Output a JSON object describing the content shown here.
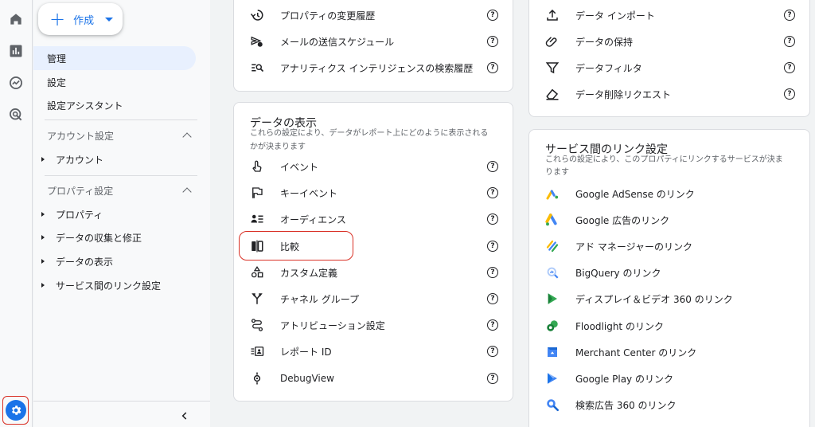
{
  "rail": {
    "icons": [
      "home-icon",
      "reports-icon",
      "explore-icon",
      "advertising-icon",
      "gear-icon"
    ]
  },
  "sidebar": {
    "create_label": "作成",
    "top_items": [
      "管理",
      "設定",
      "設定アシスタント"
    ],
    "account_section": {
      "title": "アカウント設定",
      "items": [
        "アカウント"
      ]
    },
    "property_section": {
      "title": "プロパティ設定",
      "items": [
        "プロパティ",
        "データの収集と修正",
        "データの表示",
        "サービス間のリンク設定"
      ]
    }
  },
  "card1": {
    "rows": [
      "プロパティの変更履歴",
      "メールの送信スケジュール",
      "アナリティクス インテリジェンスの検索履歴"
    ]
  },
  "card2": {
    "title": "データの表示",
    "desc_line1": "これらの設定により、データがレポート上にどのように表示される",
    "desc_line2": "かが決まります",
    "rows": [
      "イベント",
      "キーイベント",
      "オーディエンス",
      "比較",
      "カスタム定義",
      "チャネル グループ",
      "アトリビューション設定",
      "レポート ID",
      "DebugView"
    ]
  },
  "card3": {
    "rows": [
      "データ インポート",
      "データの保持",
      "データフィルタ",
      "データ削除リクエスト"
    ]
  },
  "card4": {
    "title": "サービス間のリンク設定",
    "desc_line1": "これらの設定により、このプロパティにリンクするサービスが決ま",
    "desc_line2": "ります",
    "rows": [
      "Google AdSense のリンク",
      "Google 広告のリンク",
      "アド マネージャーのリンク",
      "BigQuery のリンク",
      "ディスプレイ＆ビデオ 360 のリンク",
      "Floodlight のリンク",
      "Merchant Center のリンク",
      "Google Play のリンク",
      "検索広告 360 のリンク"
    ]
  },
  "help_glyph": "?",
  "colors": {
    "accent": "#1a73e8",
    "highlight": "#d93025"
  }
}
